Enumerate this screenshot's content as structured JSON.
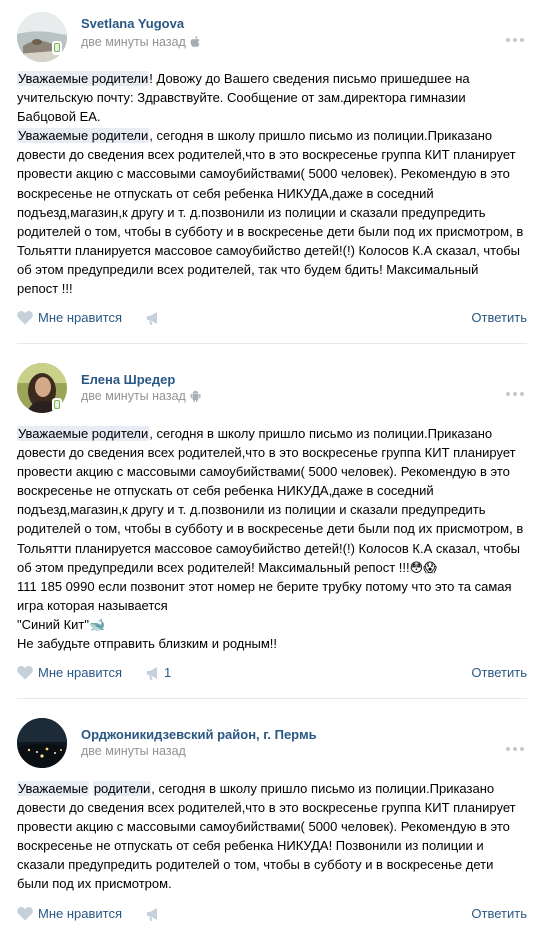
{
  "posts": [
    {
      "author": "Svetlana Yugova",
      "time": "две минуты назад",
      "device_icon": "apple-icon",
      "like_label": "Мне нравится",
      "share_count": "",
      "reply_label": "Ответить",
      "lines": [
        [
          {
            "hl": true,
            "t": "Уважаемые родители"
          },
          {
            "t": "! Довожу до Вашего сведения письмо пришедшее на"
          }
        ],
        [
          {
            "t": "учительскую почту: Здравствуйте. Сообщение от зам.директора гимназии"
          }
        ],
        [
          {
            "t": "Бабцовой ЕА."
          }
        ],
        [
          {
            "hl": true,
            "t": "Уважаемые родители"
          },
          {
            "t": ", сегодня в школу пришло письмо из полиции.Приказано"
          }
        ],
        [
          {
            "t": "довести до сведения всех родителей,что в это воскресенье группа КИТ планирует"
          }
        ],
        [
          {
            "t": "провести акцию с массовыми самоубийствами( 5000 человек). Рекомендую в это"
          }
        ],
        [
          {
            "t": "воскресенье не отпускать от себя ребенка НИКУДА,даже в соседний"
          }
        ],
        [
          {
            "t": "подъезд,магазин,к другу и т. д.позвонили из полиции и сказали предупредить"
          }
        ],
        [
          {
            "t": "родителей о том, чтобы в субботу и в воскресенье дети были под их присмотром, в"
          }
        ],
        [
          {
            "t": "Тольятти планируется массовое самоубийство детей!(!) Колосов К.А сказал, чтобы"
          }
        ],
        [
          {
            "t": "об этом предупредили всех родителей, так что будем бдить! Максимальный"
          }
        ],
        [
          {
            "t": "репост !!!"
          }
        ]
      ]
    },
    {
      "author": "Елена Шредер",
      "time": "две минуты назад",
      "device_icon": "android-icon",
      "like_label": "Мне нравится",
      "share_count": "1",
      "reply_label": "Ответить",
      "lines": [
        [
          {
            "hl": true,
            "t": "Уважаемые родители"
          },
          {
            "t": ", сегодня в школу пришло письмо из полиции.Приказано"
          }
        ],
        [
          {
            "t": "довести до сведения всех родителей,что в это воскресенье группа КИТ планирует"
          }
        ],
        [
          {
            "t": "провести акцию с массовыми самоубийствами( 5000 человек). Рекомендую в это"
          }
        ],
        [
          {
            "t": "воскресенье не отпускать от себя ребенка НИКУДА,даже в соседний"
          }
        ],
        [
          {
            "t": "подъезд,магазин,к другу и т. д.позвонили из полиции и сказали предупредить"
          }
        ],
        [
          {
            "t": "родителей о том, чтобы в субботу и в воскресенье дети были под их присмотром, в"
          }
        ],
        [
          {
            "t": "Тольятти планируется массовое самоубийство детей!(!) Колосов К.А сказал, чтобы"
          }
        ],
        [
          {
            "t": "об этом предупредили всех родителей! Максимальный репост !!!😳😱"
          }
        ],
        [
          {
            "t": "111 185 0990 если позвонит этот номер не берите трубку потому что это та самая"
          }
        ],
        [
          {
            "t": "игра которая называется"
          }
        ],
        [
          {
            "t": "\"Синий Кит\"🐋"
          }
        ],
        [
          {
            "t": "Не забудьте отправить близким и родным!!"
          }
        ]
      ]
    },
    {
      "author": "Орджоникидзевский район, г. Пермь",
      "time": "две минуты назад",
      "device_icon": "",
      "like_label": "Мне нравится",
      "share_count": "",
      "reply_label": "Ответить",
      "lines": [
        [
          {
            "hl": true,
            "t": "Уважаемые"
          },
          {
            "t": " "
          },
          {
            "hl": true,
            "t": "родители"
          },
          {
            "t": ", сегодня в школу пришло письмо из полиции.Приказано"
          }
        ],
        [
          {
            "t": "довести до сведения всех родителей,что в это воскресенье группа КИТ планирует"
          }
        ],
        [
          {
            "t": "провести акцию с массовыми самоубийствами( 5000 человек). Рекомендую в это"
          }
        ],
        [
          {
            "t": "воскресенье не отпускать от себя ребенка НИКУДА! Позвонили из полиции и"
          }
        ],
        [
          {
            "t": "сказали предупредить родителей о том, чтобы в субботу и в воскресенье дети"
          }
        ],
        [
          {
            "t": "были под их присмотром."
          }
        ]
      ]
    }
  ]
}
